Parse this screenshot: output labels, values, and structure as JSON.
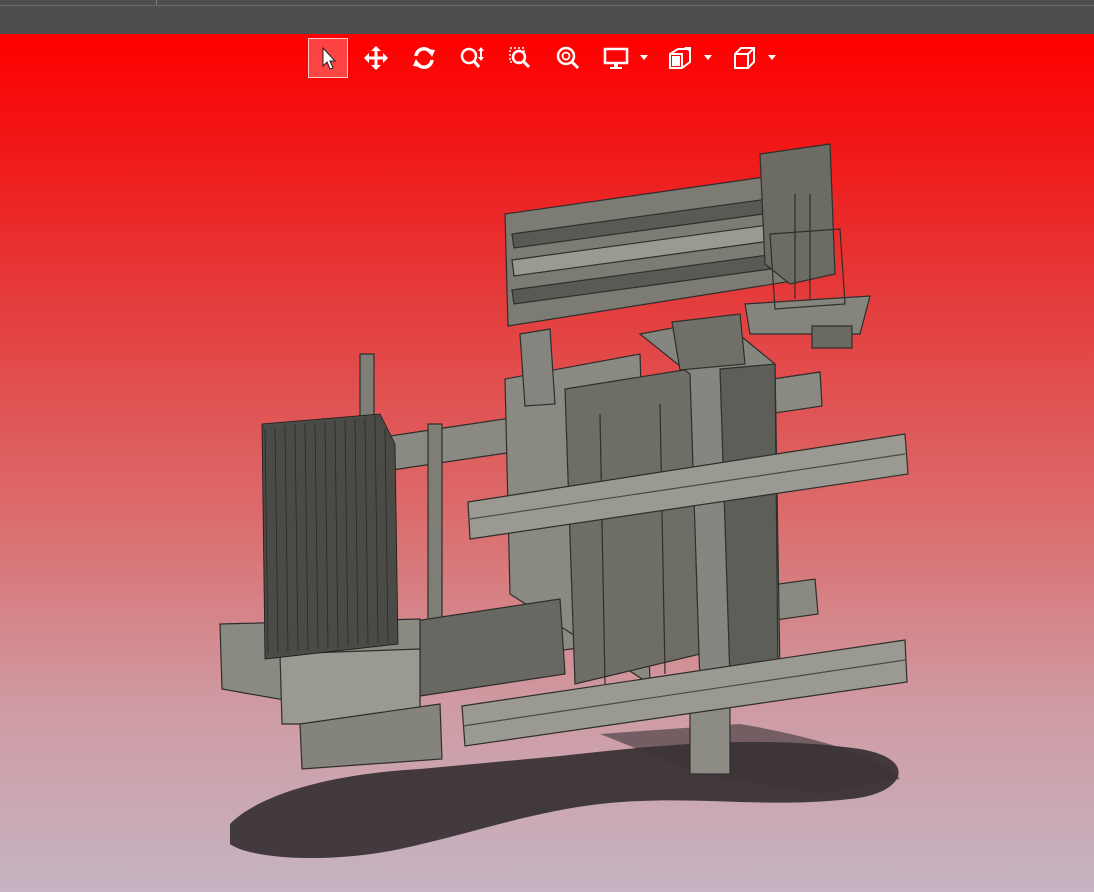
{
  "colors": {
    "title_bar": "#4e4e4e",
    "viewport_top": "#ff0000",
    "viewport_bottom": "#c6b4c2",
    "model_metal": "#7a7a72",
    "model_dark": "#3a3a36",
    "shadow": "#2a2628"
  },
  "toolbar": {
    "tools": [
      {
        "name": "select-tool",
        "icon": "cursor-arrow-icon",
        "active": true
      },
      {
        "name": "pan-tool",
        "icon": "move-arrows-icon",
        "active": false
      },
      {
        "name": "rotate-tool",
        "icon": "rotate-icon",
        "active": false
      },
      {
        "name": "zoom-in-out-tool",
        "icon": "zoom-updown-icon",
        "active": false
      },
      {
        "name": "zoom-window-tool",
        "icon": "zoom-window-icon",
        "active": false
      },
      {
        "name": "zoom-fit-tool",
        "icon": "zoom-fit-icon",
        "active": false
      },
      {
        "name": "display-mode-dropdown",
        "icon": "monitor-icon",
        "has_dropdown": true
      },
      {
        "name": "section-view-dropdown",
        "icon": "section-cube-icon",
        "has_dropdown": true
      },
      {
        "name": "view-orientation-dropdown",
        "icon": "cube-icon",
        "has_dropdown": true
      }
    ]
  }
}
